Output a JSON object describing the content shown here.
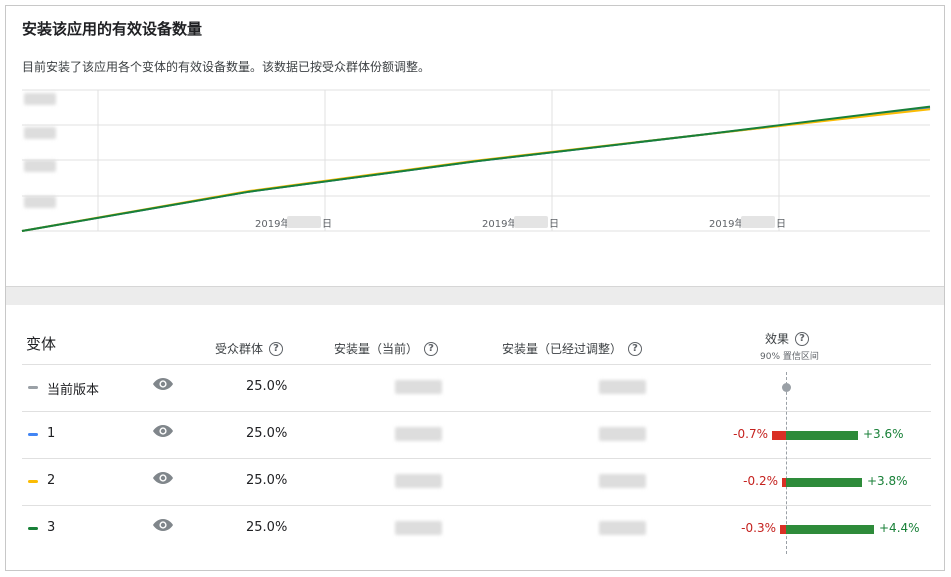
{
  "header": {
    "title": "安装该应用的有效设备数量",
    "description": "目前安装了该应用各个变体的有效设备数量。该数据已按受众群体份额调整。"
  },
  "chart_data": {
    "type": "line",
    "x_ticks": [
      "2019年",
      "2019年",
      "2019年"
    ],
    "x_tick_suffix": "日",
    "series": [
      {
        "color": "#9aa0a6",
        "values": [
          0,
          0.31,
          0.55,
          0.76,
          0.97
        ]
      },
      {
        "color": "#4285f4",
        "values": [
          0,
          0.31,
          0.55,
          0.76,
          0.965
        ]
      },
      {
        "color": "#fbbc04",
        "values": [
          0,
          0.315,
          0.555,
          0.76,
          0.96
        ]
      },
      {
        "color": "#188038",
        "values": [
          0,
          0.31,
          0.55,
          0.76,
          0.98
        ]
      }
    ],
    "grid": true
  },
  "table": {
    "col_variant": "变体",
    "col_audience": "受众群体",
    "col_installs_current": "安装量（当前）",
    "col_installs_adjusted": "安装量（已经过调整）",
    "col_effect": "效果",
    "col_effect_sub": "90% 置信区间",
    "help_glyph": "?",
    "rows": [
      {
        "label": "当前版本",
        "color": "#9aa0a6",
        "audience": "25.0%",
        "ci_low": "",
        "ci_high": "",
        "low": 0,
        "high": 0
      },
      {
        "label": "1",
        "color": "#4285f4",
        "audience": "25.0%",
        "ci_low": "-0.7%",
        "ci_high": "+3.6%",
        "low": -0.7,
        "high": 3.6
      },
      {
        "label": "2",
        "color": "#fbbc04",
        "audience": "25.0%",
        "ci_low": "-0.2%",
        "ci_high": "+3.8%",
        "low": -0.2,
        "high": 3.8
      },
      {
        "label": "3",
        "color": "#188038",
        "audience": "25.0%",
        "ci_low": "-0.3%",
        "ci_high": "+4.4%",
        "low": -0.3,
        "high": 4.4
      }
    ]
  }
}
